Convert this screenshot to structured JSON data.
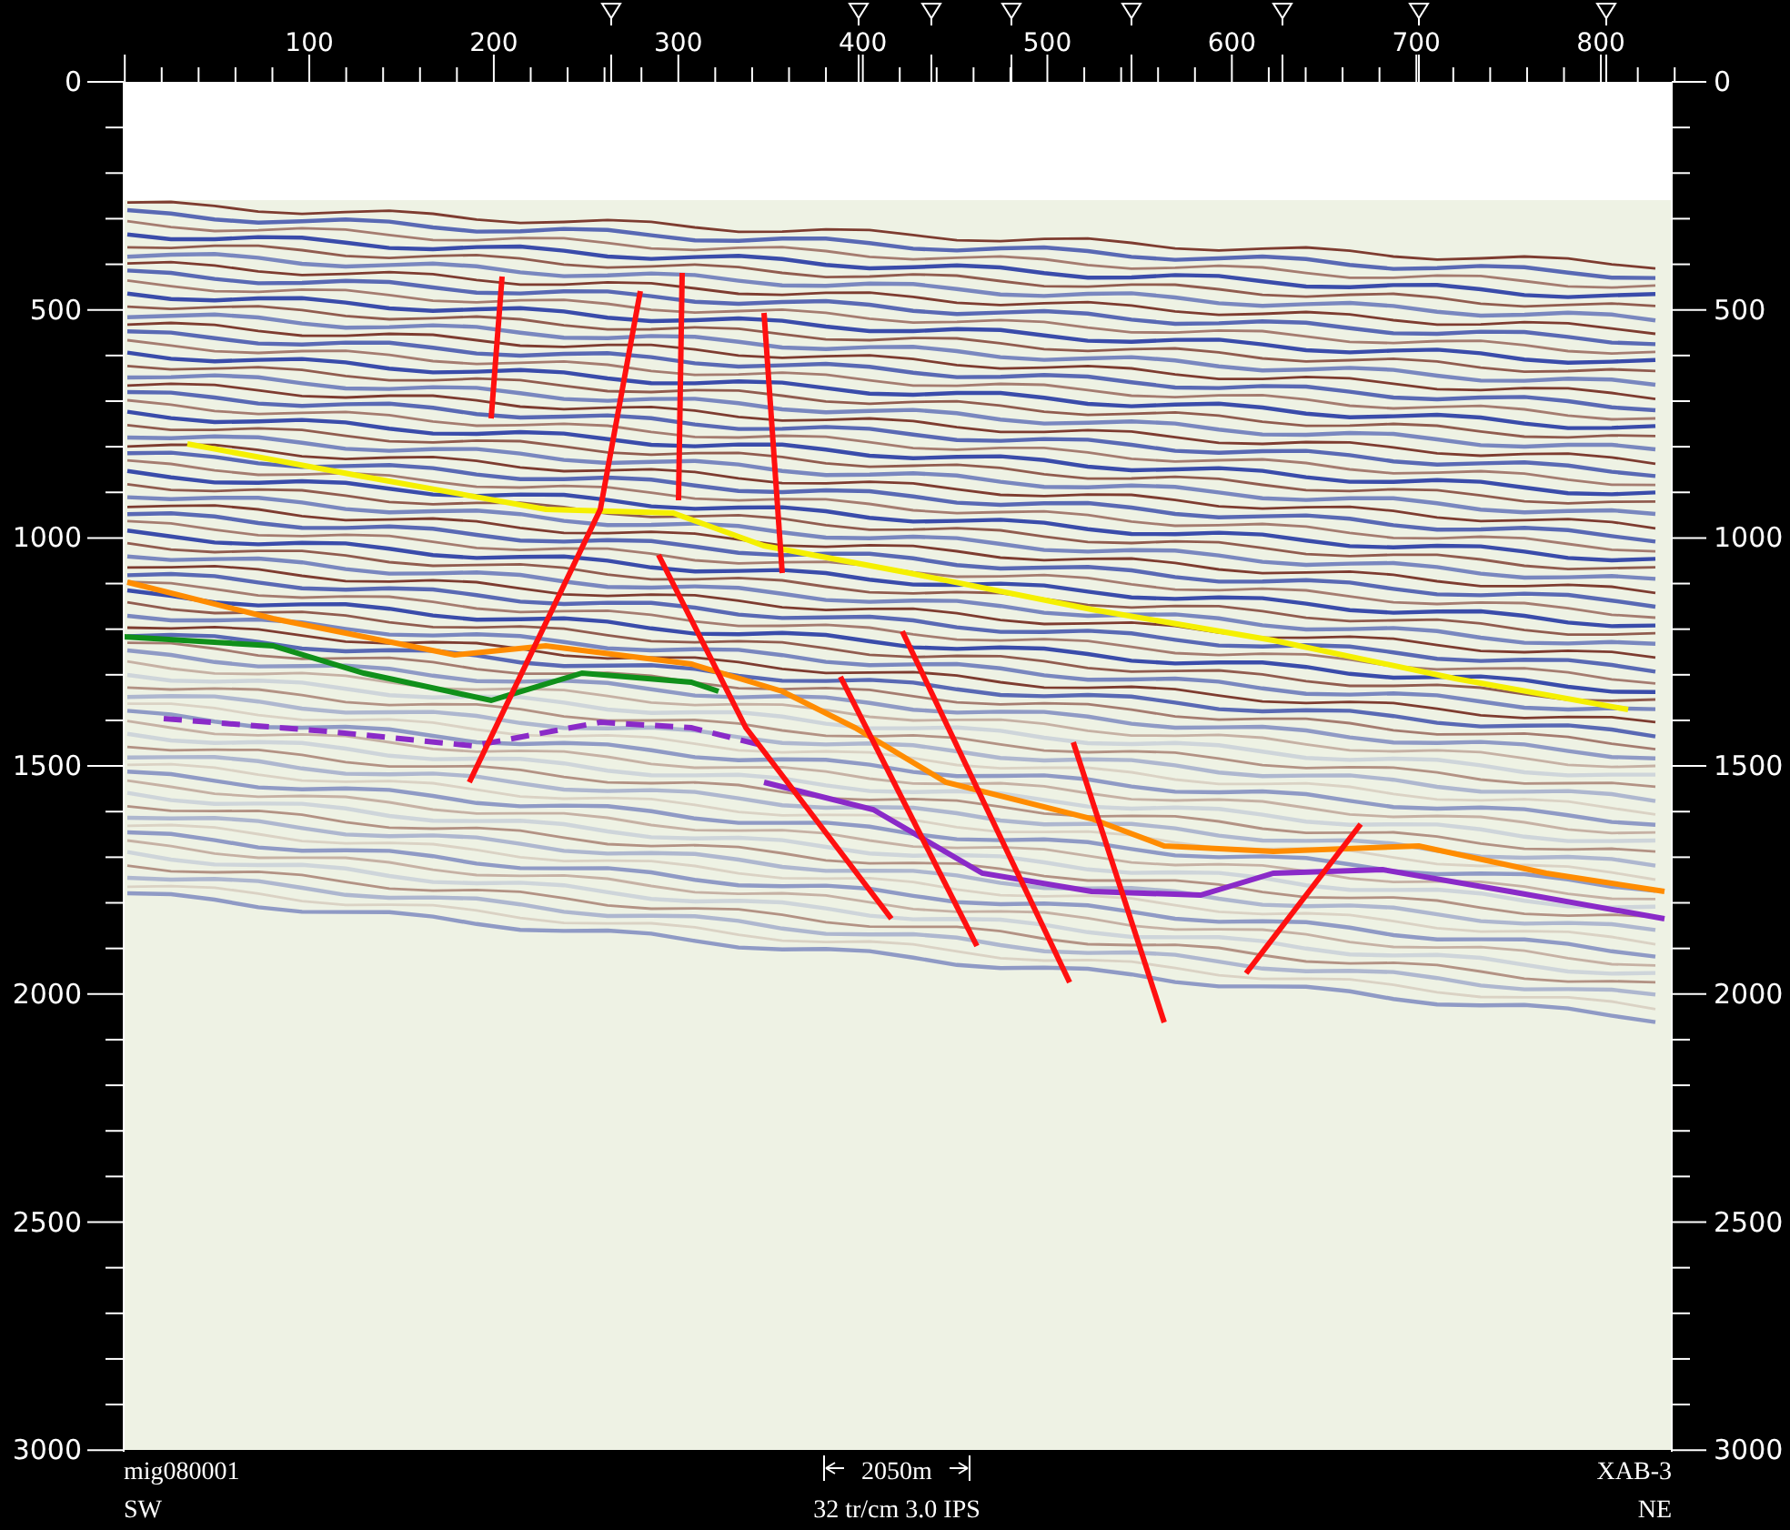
{
  "top_axis": {
    "labels": [
      "100",
      "200",
      "300",
      "400",
      "500",
      "600",
      "700",
      "800"
    ]
  },
  "left_axis": {
    "labels": [
      "0",
      "500",
      "1000",
      "1500",
      "2000",
      "2500",
      "3000"
    ]
  },
  "right_axis": {
    "labels": [
      "0",
      "500",
      "1000",
      "1500",
      "2000",
      "2500",
      "3000"
    ]
  },
  "footer": {
    "line_name": "mig080001",
    "scale": "2050m",
    "well": "XAB-3",
    "left_direction": "SW",
    "parameters": "32 tr/cm 3.0 IPS",
    "right_direction": "NE"
  }
}
